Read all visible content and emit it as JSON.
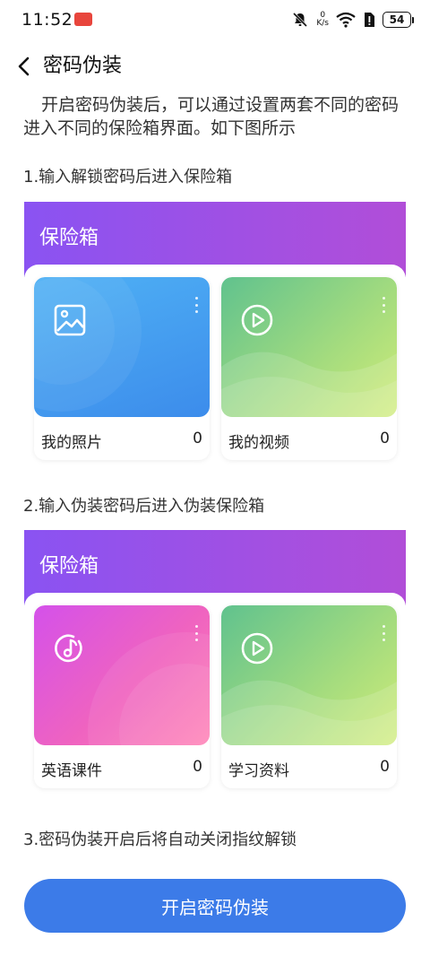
{
  "status_bar": {
    "time": "11:52",
    "net_speed_value": "0",
    "net_speed_unit": "K/s",
    "battery": "54"
  },
  "header": {
    "title": "密码伪装"
  },
  "intro": "开启密码伪装后，可以通过设置两套不同的密码进入不同的保险箱界面。如下图所示",
  "steps": [
    {
      "label": "1.输入解锁密码后进入保险箱"
    },
    {
      "label": "2.输入伪装密码后进入伪装保险箱"
    },
    {
      "label": "3.密码伪装开启后将自动关闭指纹解锁"
    }
  ],
  "vaults": [
    {
      "title": "保险箱",
      "albums": [
        {
          "name": "我的照片",
          "count": "0",
          "icon": "image-icon",
          "color": "#4a9ff2"
        },
        {
          "name": "我的视频",
          "count": "0",
          "icon": "play-icon",
          "color": "#8ed67f"
        }
      ]
    },
    {
      "title": "保险箱",
      "albums": [
        {
          "name": "英语课件",
          "count": "0",
          "icon": "music-icon",
          "color": "#e65cd2"
        },
        {
          "name": "学习资料",
          "count": "0",
          "icon": "play-icon",
          "color": "#8ed67f"
        }
      ]
    }
  ],
  "primary_button": {
    "label": "开启密码伪装",
    "color": "#3c7be8"
  }
}
